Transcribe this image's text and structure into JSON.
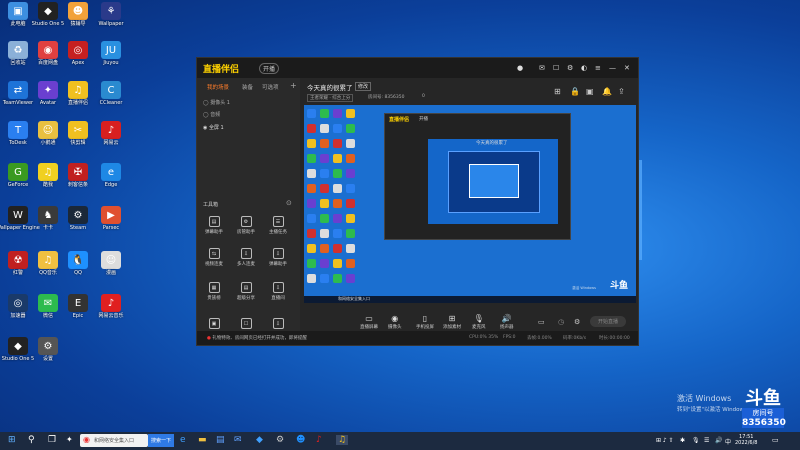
{
  "desktop_icons": [
    {
      "label": "此电脑",
      "color": "#3d8fe0",
      "glyph": "▣"
    },
    {
      "label": "Studio One 5",
      "color": "#222",
      "glyph": "◆"
    },
    {
      "label": "猿辅导",
      "color": "#f2a23a",
      "glyph": "☻"
    },
    {
      "label": "Wallpaper",
      "color": "#2a3a8a",
      "glyph": "⚘"
    },
    {
      "label": "回收站",
      "color": "#8bb0d8",
      "glyph": "♻"
    },
    {
      "label": "百度网盘",
      "color": "#e04040",
      "glyph": "◉"
    },
    {
      "label": "Apex",
      "color": "#c62020",
      "glyph": "◎"
    },
    {
      "label": "Jiuyou",
      "color": "#2a90e0",
      "glyph": "JU"
    },
    {
      "label": "TeamViewer",
      "color": "#1e73d8",
      "glyph": "⇄"
    },
    {
      "label": "Avatar",
      "color": "#6a3fd0",
      "glyph": "✦"
    },
    {
      "label": "直播伴侣",
      "color": "#f0c020",
      "glyph": "♫"
    },
    {
      "label": "CCleaner",
      "color": "#2a8ad0",
      "glyph": "C"
    },
    {
      "label": "ToDesk",
      "color": "#2a7ff0",
      "glyph": "T"
    },
    {
      "label": "小鹅通",
      "color": "#e8c040",
      "glyph": "☺"
    },
    {
      "label": "快剪辑",
      "color": "#f0c020",
      "glyph": "✂"
    },
    {
      "label": "网易云",
      "color": "#d82020",
      "glyph": "♪"
    },
    {
      "label": "GeForce",
      "color": "#3a9a20",
      "glyph": "G"
    },
    {
      "label": "酷我",
      "color": "#f0d020",
      "glyph": "♫"
    },
    {
      "label": "刺客信条",
      "color": "#c02020",
      "glyph": "✠"
    },
    {
      "label": "Edge",
      "color": "#1e88e5",
      "glyph": "e"
    },
    {
      "label": "Wallpaper Engine",
      "color": "#222",
      "glyph": "W"
    },
    {
      "label": "卡卡",
      "color": "#3a3a3a",
      "glyph": "♞"
    },
    {
      "label": "Steam",
      "color": "#1b2838",
      "glyph": "⚙"
    },
    {
      "label": "Parsec",
      "color": "#e05030",
      "glyph": "▶"
    },
    {
      "label": "红警",
      "color": "#c02020",
      "glyph": "☢"
    },
    {
      "label": "QQ音乐",
      "color": "#f0c040",
      "glyph": "♫"
    },
    {
      "label": "QQ",
      "color": "#1e90ff",
      "glyph": "🐧"
    },
    {
      "label": "漫画",
      "color": "#ddd",
      "glyph": "☺"
    },
    {
      "label": "加速器",
      "color": "#1a3a6a",
      "glyph": "◎"
    },
    {
      "label": "微信",
      "color": "#2dbb4e",
      "glyph": "✉"
    },
    {
      "label": "Epic",
      "color": "#333",
      "glyph": "E"
    },
    {
      "label": "网易云音乐",
      "color": "#e02020",
      "glyph": "♪"
    },
    {
      "label": "Studio One 5",
      "color": "#222",
      "glyph": "◆"
    },
    {
      "label": "设置",
      "color": "#555",
      "glyph": "⚙"
    }
  ],
  "app": {
    "logo": "直播伴侣",
    "version_badge": "开播",
    "left_tabs": [
      "我的场景",
      "装备",
      "可选项"
    ],
    "layers": [
      "摄像头 1",
      "音频",
      "全屏 1"
    ],
    "tools_title": "工具箱",
    "tools": [
      {
        "label": "弹幕助手",
        "glyph": "▤"
      },
      {
        "label": "房管助手",
        "glyph": "⚙"
      },
      {
        "label": "主播任务",
        "glyph": "☰"
      },
      {
        "label": "视频连麦",
        "glyph": "⇆"
      },
      {
        "label": "多人连麦",
        "glyph": "⇩"
      },
      {
        "label": "弹幕助手",
        "glyph": "⇩"
      },
      {
        "label": "贵族榜",
        "glyph": "▦"
      },
      {
        "label": "超级分享",
        "glyph": "▤"
      },
      {
        "label": "直播间",
        "glyph": "⇩"
      }
    ],
    "room_title": "今天真的很累了",
    "edit_label": "修改",
    "meta": [
      "王者荣耀 · 综合上分",
      "房间号: 8356350",
      "0"
    ],
    "controls": [
      {
        "label": "直播屏幕",
        "glyph": "▭"
      },
      {
        "label": "摄像头",
        "glyph": "◉"
      },
      {
        "label": "手机投屏",
        "glyph": "▯"
      },
      {
        "label": "添加素材",
        "glyph": "⊞"
      },
      {
        "label": "麦克风",
        "glyph": "🎙"
      },
      {
        "label": "扬声器",
        "glyph": "🔊"
      }
    ],
    "start_live": "开始直播",
    "status_msg": "礼物特效、房间网页已经打开并成功，即将提醒",
    "stats": [
      "CPU:0% 35%",
      "FPS:0",
      "丢帧:0.00%",
      "码率:0Kb/s",
      "时长:00:00:00"
    ],
    "preview_logo": "斗鱼"
  },
  "watermark": {
    "activate_title": "激活 Windows",
    "activate_sub": "转到\"设置\"以激活 Windows。",
    "douyu_logo": "斗鱼",
    "room_label": "房间号",
    "room_number": "8356350"
  },
  "taskbar": {
    "search_text": "和网络安全集入口",
    "search_btn": "搜索一下",
    "time": "17:51",
    "date": "2022/6/8",
    "ime": "中"
  }
}
